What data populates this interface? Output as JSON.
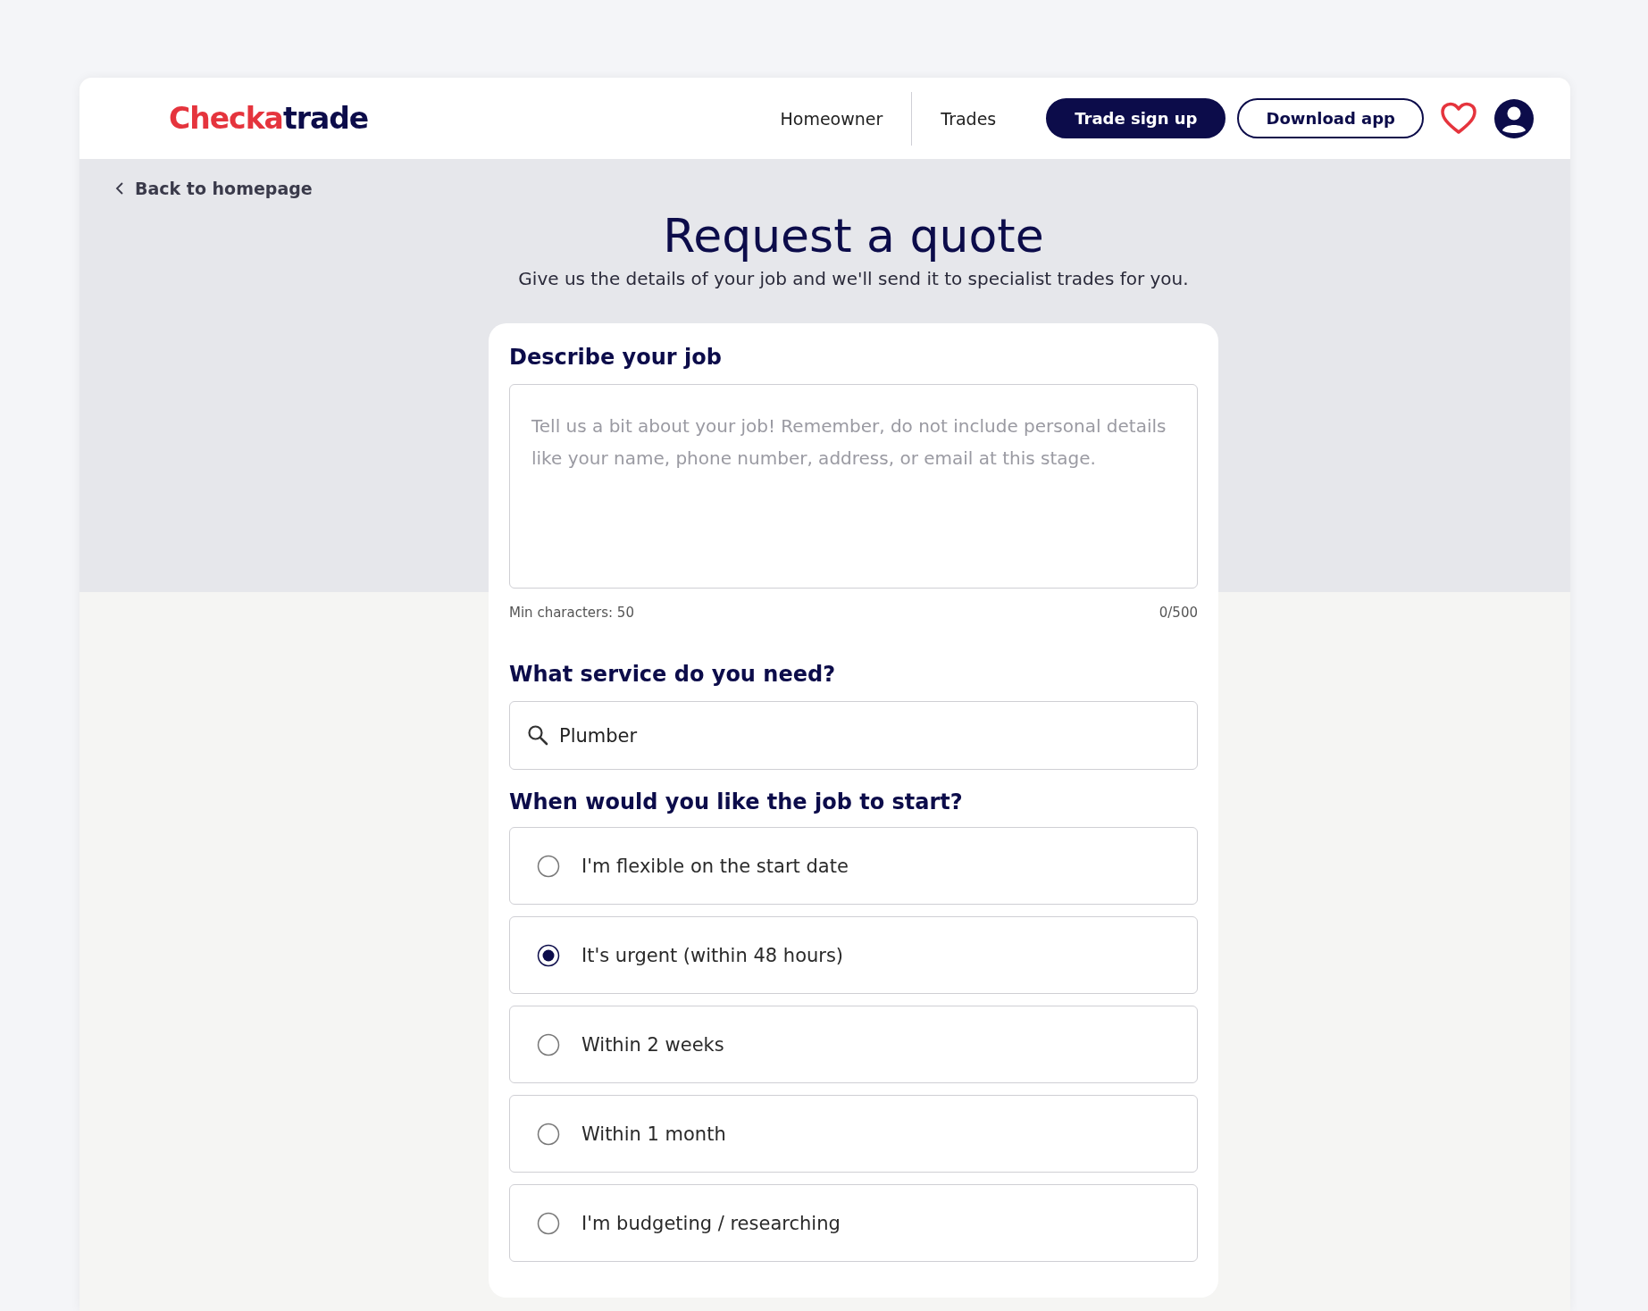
{
  "header": {
    "logo": {
      "part_1": "Checka",
      "part_2": "trade"
    },
    "nav": [
      {
        "label": "Homeowner"
      },
      {
        "label": "Trades"
      }
    ],
    "buttons": [
      {
        "label": "Trade sign up",
        "kind": "filled"
      },
      {
        "label": "Download app",
        "kind": "outline"
      }
    ]
  },
  "back_link": "Back to homepage",
  "title": "Request a quote",
  "subtitle": "Give us the details of your job and we'll send it to specialist trades for you.",
  "form": {
    "description": {
      "heading": "Describe your job",
      "placeholder": "Tell us a bit about your job! Remember, do not include personal details like your name, phone number, address, or email at this stage.",
      "hint": "Min characters: 50",
      "counter": "0/500"
    },
    "service": {
      "heading": "What service do you need?",
      "value": "Plumber"
    },
    "start": {
      "heading": "When would you like the job to start?",
      "options": [
        {
          "label": "I'm flexible on the start date",
          "selected": false
        },
        {
          "label": "It's urgent (within 48 hours)",
          "selected": true
        },
        {
          "label": "Within 2 weeks",
          "selected": false
        },
        {
          "label": "Within 1 month",
          "selected": false
        },
        {
          "label": "I'm budgeting / researching",
          "selected": false
        }
      ]
    }
  }
}
